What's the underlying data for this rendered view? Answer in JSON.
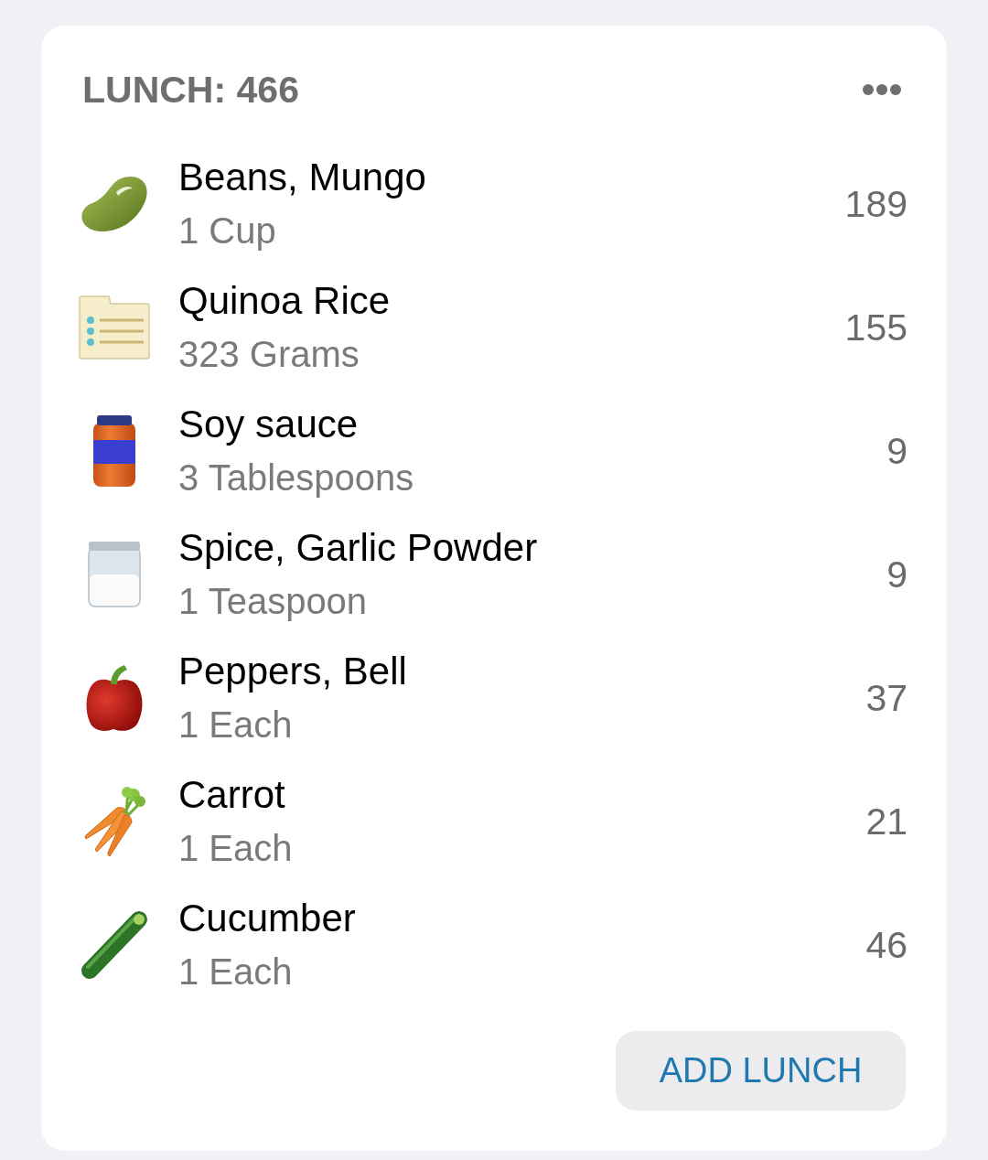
{
  "meal": {
    "title": "LUNCH: 466",
    "foods": [
      {
        "name": "Beans, Mungo",
        "amount": "1 Cup",
        "calories": "189"
      },
      {
        "name": "Quinoa Rice",
        "amount": "323 Grams",
        "calories": "155"
      },
      {
        "name": "Soy sauce",
        "amount": "3 Tablespoons",
        "calories": "9"
      },
      {
        "name": "Spice, Garlic Powder",
        "amount": "1 Teaspoon",
        "calories": "9"
      },
      {
        "name": "Peppers, Bell",
        "amount": "1 Each",
        "calories": "37"
      },
      {
        "name": "Carrot",
        "amount": "1 Each",
        "calories": "21"
      },
      {
        "name": "Cucumber",
        "amount": "1 Each",
        "calories": "46"
      }
    ],
    "add_button": "ADD LUNCH"
  }
}
